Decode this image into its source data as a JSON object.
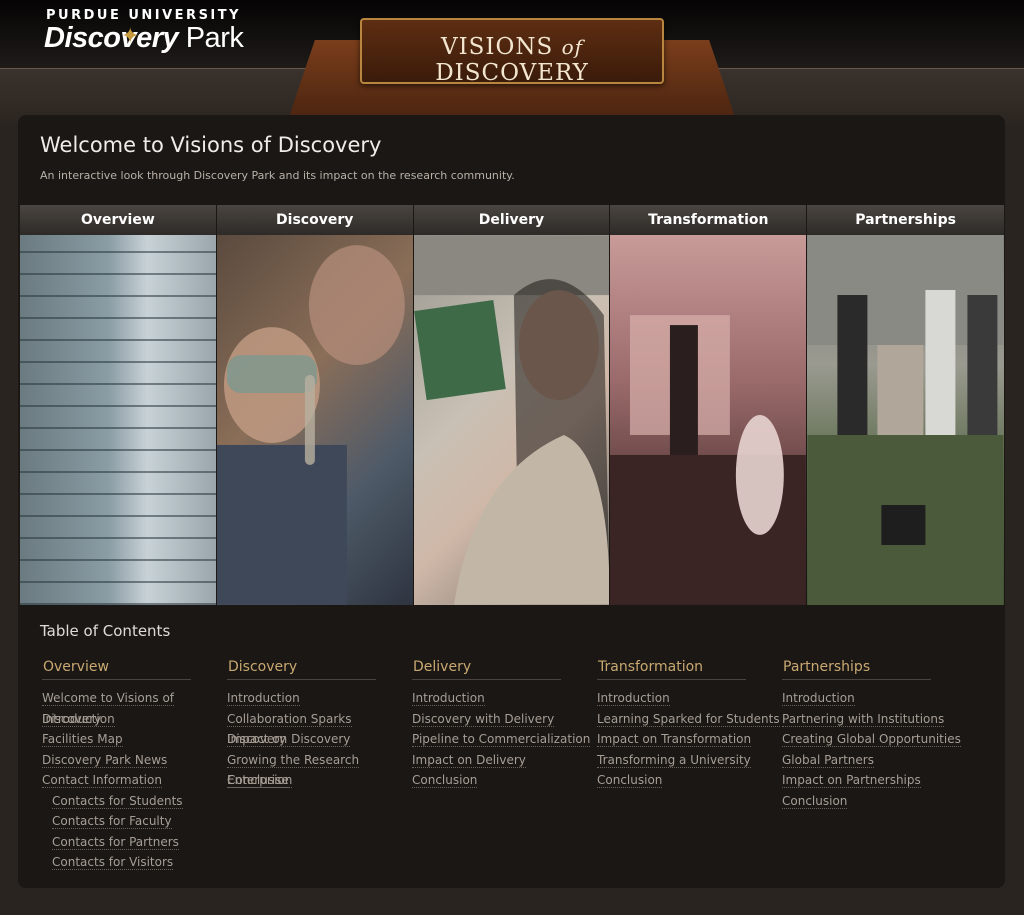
{
  "header": {
    "university": "PURDUE UNIVERSITY",
    "logo_main": "Discovery",
    "logo_park": "Park",
    "banner_left": "VISIONS",
    "banner_of": "of",
    "banner_right": "DISCOVERY"
  },
  "main": {
    "title": "Welcome to Visions of Discovery",
    "subtitle": "An interactive look through Discovery Park and its impact on the research community.",
    "sections": [
      {
        "label": "Overview"
      },
      {
        "label": "Discovery"
      },
      {
        "label": "Delivery"
      },
      {
        "label": "Transformation"
      },
      {
        "label": "Partnerships"
      }
    ]
  },
  "toc": {
    "title": "Table of Contents",
    "columns": [
      {
        "head": "Overview",
        "links": [
          "Welcome to Visions of Discovery",
          "Introduction",
          "Facilities Map",
          "Discovery Park News",
          "Contact Information"
        ],
        "sublinks": [
          "Contacts for Students",
          "Contacts for Faculty",
          "Contacts for Partners",
          "Contacts for Visitors"
        ]
      },
      {
        "head": "Discovery",
        "links": [
          "Introduction",
          "Collaboration Sparks Discovery",
          "Impact on Discovery",
          "Growing the Research Enterprise",
          "Conclusion"
        ]
      },
      {
        "head": "Delivery",
        "links": [
          "Introduction",
          "Discovery with Delivery",
          "Pipeline to Commercialization",
          "Impact on Delivery",
          "Conclusion"
        ]
      },
      {
        "head": "Transformation",
        "links": [
          "Introduction",
          "Learning Sparked for Students",
          "Impact on Transformation",
          "Transforming a University",
          "Conclusion"
        ]
      },
      {
        "head": "Partnerships",
        "links": [
          "Introduction",
          "Partnering with Institutions",
          "Creating Global Opportunities",
          "Global Partners",
          "Impact on Partnerships",
          "Conclusion"
        ]
      }
    ]
  },
  "colors": {
    "accent_gold": "#c9a971",
    "banner_brown": "#5e2e12",
    "panel_bg": "#1a1715"
  }
}
